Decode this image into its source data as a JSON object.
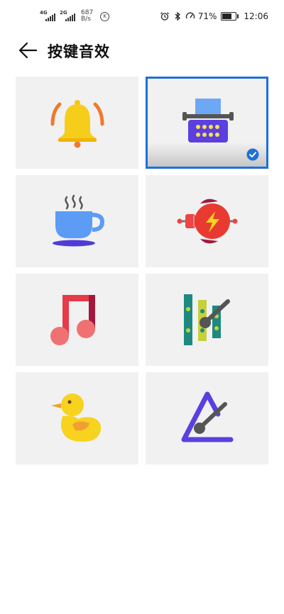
{
  "status_bar": {
    "signal1_label": "4G",
    "signal2_label": "2G",
    "speed_value": "687",
    "speed_unit": "B/s",
    "k_badge": "K",
    "battery": "71%",
    "time": "12:06"
  },
  "header": {
    "title": "按键音效"
  },
  "tiles": [
    {
      "name": "bell",
      "selected": false
    },
    {
      "name": "typewriter",
      "selected": true
    },
    {
      "name": "coffee-cup",
      "selected": false
    },
    {
      "name": "robot",
      "selected": false
    },
    {
      "name": "music-note",
      "selected": false
    },
    {
      "name": "xylophone",
      "selected": false
    },
    {
      "name": "duck",
      "selected": false
    },
    {
      "name": "triangle",
      "selected": false
    }
  ],
  "colors": {
    "selection_border": "#1e70d8",
    "tile_background": "#f1f1f1"
  }
}
